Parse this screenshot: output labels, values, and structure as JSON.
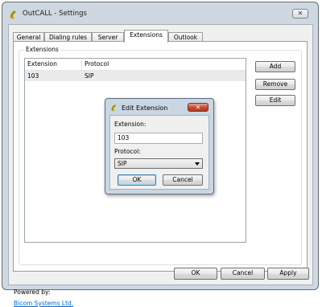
{
  "window": {
    "title": "OutCALL - Settings",
    "close_glyph": "✕",
    "icon": "phone-handset-icon"
  },
  "tabs": [
    {
      "label": "General",
      "active": false
    },
    {
      "label": "Dialing rules",
      "active": false
    },
    {
      "label": "Server",
      "active": false
    },
    {
      "label": "Extensions",
      "active": true
    },
    {
      "label": "Outlook",
      "active": false
    }
  ],
  "extensions_group": {
    "title": "Extensions",
    "columns": [
      "Extension",
      "Protocol"
    ],
    "rows": [
      {
        "extension": "103",
        "protocol": "SIP"
      }
    ],
    "buttons": {
      "add": "Add",
      "remove": "Remove",
      "edit": "Edit"
    }
  },
  "footer": {
    "powered_by": "Powered by:",
    "link": "Bicom Systems Ltd.",
    "ok": "OK",
    "cancel": "Cancel",
    "apply": "Apply"
  },
  "edit_dialog": {
    "title": "Edit Extension",
    "close_glyph": "✕",
    "extension_label": "Extension:",
    "extension_value": "103",
    "protocol_label": "Protocol:",
    "protocol_value": "SIP",
    "ok": "OK",
    "cancel": "Cancel"
  }
}
